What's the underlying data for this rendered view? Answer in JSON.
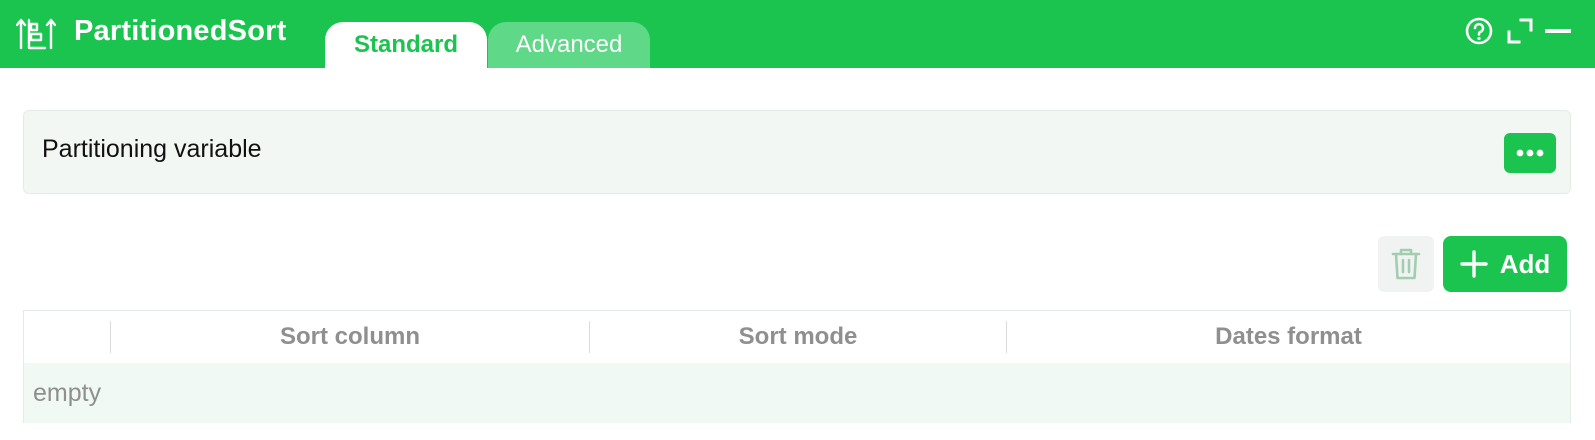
{
  "app": {
    "title": "PartitionedSort",
    "icon": "sort-ascending-icon"
  },
  "tabs": [
    {
      "label": "Standard",
      "active": true
    },
    {
      "label": "Advanced",
      "active": false
    }
  ],
  "header_icons": [
    "help-icon",
    "expand-icon",
    "minimize-icon"
  ],
  "partition": {
    "label": "Partitioning variable",
    "more_icon": "more-options-icon"
  },
  "toolbar": {
    "add_label": "Add",
    "delete_icon": "trash-icon",
    "add_icon": "plus-icon"
  },
  "table": {
    "columns": [
      "",
      "Sort column",
      "Sort mode",
      "Dates format"
    ],
    "empty_text": "empty"
  },
  "colors": {
    "accent": "#1bc44f",
    "tab_inactive": "#5fd888",
    "panel_bg": "#f3f7f4",
    "muted_text": "#8f8f8f"
  }
}
